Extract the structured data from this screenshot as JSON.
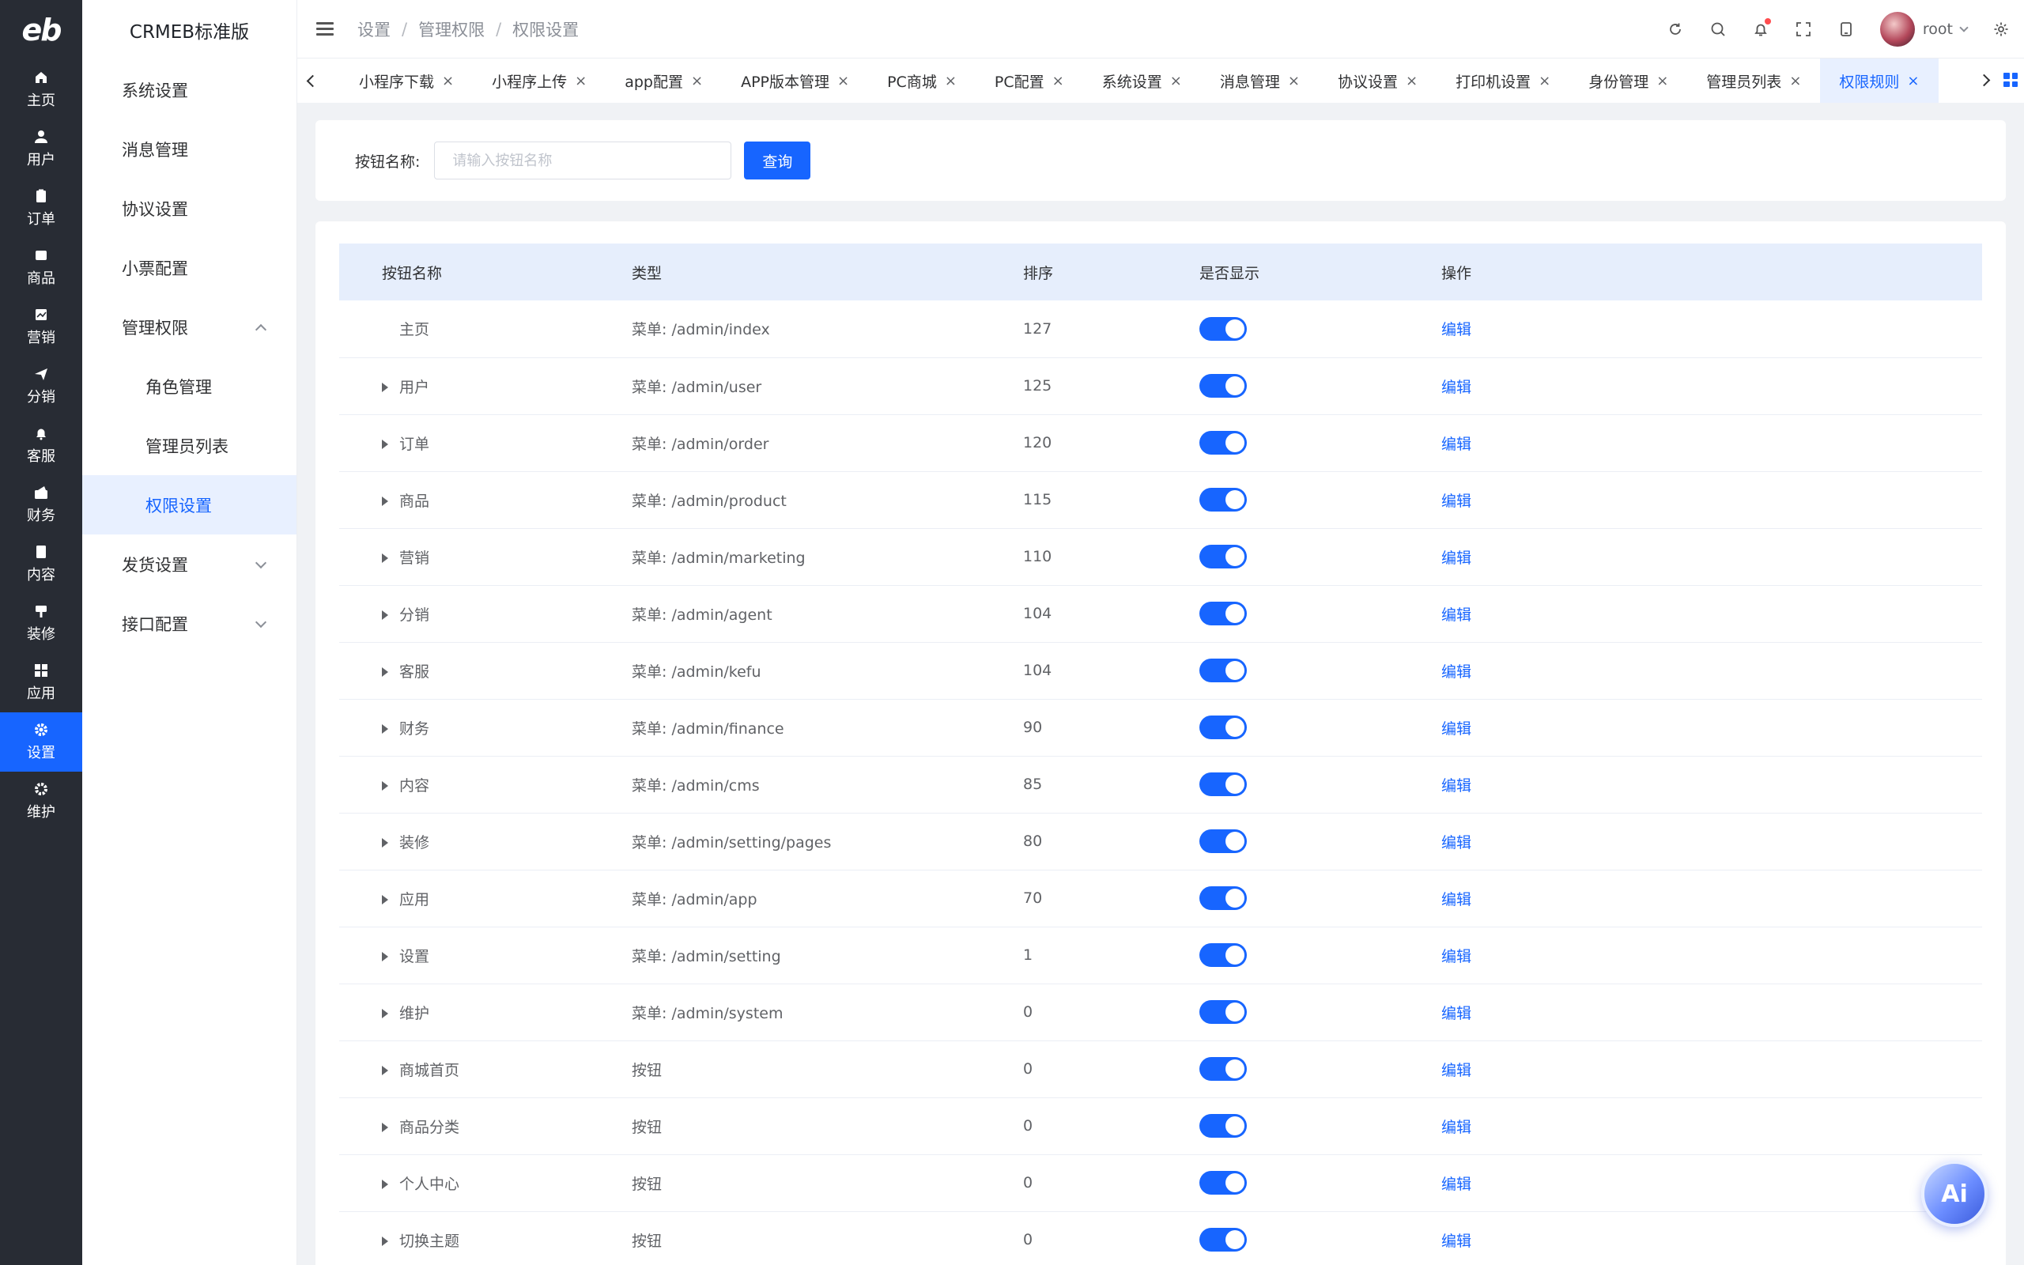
{
  "rail": {
    "logo": "eb",
    "items": [
      {
        "label": "主页",
        "icon": "home-icon"
      },
      {
        "label": "用户",
        "icon": "user-icon"
      },
      {
        "label": "订单",
        "icon": "order-icon"
      },
      {
        "label": "商品",
        "icon": "product-icon"
      },
      {
        "label": "营销",
        "icon": "marketing-icon"
      },
      {
        "label": "分销",
        "icon": "distribution-icon"
      },
      {
        "label": "客服",
        "icon": "service-bell-icon"
      },
      {
        "label": "财务",
        "icon": "finance-icon"
      },
      {
        "label": "内容",
        "icon": "content-icon"
      },
      {
        "label": "装修",
        "icon": "decoration-icon"
      },
      {
        "label": "应用",
        "icon": "apps-icon"
      },
      {
        "label": "设置",
        "icon": "gear-icon",
        "active": true
      },
      {
        "label": "维护",
        "icon": "maintenance-icon"
      }
    ]
  },
  "sidebar": {
    "brand": "CRMEB标准版",
    "items": [
      {
        "label": "系统设置"
      },
      {
        "label": "消息管理"
      },
      {
        "label": "协议设置"
      },
      {
        "label": "小票配置"
      },
      {
        "label": "管理权限",
        "expanded": true
      },
      {
        "label": "角色管理",
        "sub": true
      },
      {
        "label": "管理员列表",
        "sub": true
      },
      {
        "label": "权限设置",
        "sub": true,
        "active": true
      },
      {
        "label": "发货设置",
        "collapsible": true
      },
      {
        "label": "接口配置",
        "collapsible": true
      }
    ]
  },
  "header": {
    "breadcrumb": [
      "设置",
      "管理权限",
      "权限设置"
    ],
    "breadcrumb_sep": "/",
    "username": "root"
  },
  "tags": [
    {
      "label": "小程序下载"
    },
    {
      "label": "小程序上传"
    },
    {
      "label": "app配置"
    },
    {
      "label": "APP版本管理"
    },
    {
      "label": "PC商城"
    },
    {
      "label": "PC配置"
    },
    {
      "label": "系统设置"
    },
    {
      "label": "消息管理"
    },
    {
      "label": "协议设置"
    },
    {
      "label": "打印机设置"
    },
    {
      "label": "身份管理"
    },
    {
      "label": "管理员列表"
    },
    {
      "label": "权限规则",
      "active": true
    }
  ],
  "search": {
    "label": "按钮名称:",
    "placeholder": "请输入按钮名称",
    "value": "",
    "button": "查询"
  },
  "table": {
    "columns": [
      "按钮名称",
      "类型",
      "排序",
      "是否显示",
      "操作"
    ],
    "edit_label": "编辑",
    "rows": [
      {
        "name": "主页",
        "type": "菜单: /admin/index",
        "sort": "127",
        "show": true,
        "expandable": false
      },
      {
        "name": "用户",
        "type": "菜单: /admin/user",
        "sort": "125",
        "show": true,
        "expandable": true
      },
      {
        "name": "订单",
        "type": "菜单: /admin/order",
        "sort": "120",
        "show": true,
        "expandable": true
      },
      {
        "name": "商品",
        "type": "菜单: /admin/product",
        "sort": "115",
        "show": true,
        "expandable": true
      },
      {
        "name": "营销",
        "type": "菜单: /admin/marketing",
        "sort": "110",
        "show": true,
        "expandable": true
      },
      {
        "name": "分销",
        "type": "菜单: /admin/agent",
        "sort": "104",
        "show": true,
        "expandable": true
      },
      {
        "name": "客服",
        "type": "菜单: /admin/kefu",
        "sort": "104",
        "show": true,
        "expandable": true
      },
      {
        "name": "财务",
        "type": "菜单: /admin/finance",
        "sort": "90",
        "show": true,
        "expandable": true
      },
      {
        "name": "内容",
        "type": "菜单: /admin/cms",
        "sort": "85",
        "show": true,
        "expandable": true
      },
      {
        "name": "装修",
        "type": "菜单: /admin/setting/pages",
        "sort": "80",
        "show": true,
        "expandable": true
      },
      {
        "name": "应用",
        "type": "菜单: /admin/app",
        "sort": "70",
        "show": true,
        "expandable": true
      },
      {
        "name": "设置",
        "type": "菜单: /admin/setting",
        "sort": "1",
        "show": true,
        "expandable": true
      },
      {
        "name": "维护",
        "type": "菜单: /admin/system",
        "sort": "0",
        "show": true,
        "expandable": true
      },
      {
        "name": "商城首页",
        "type": "按钮",
        "sort": "0",
        "show": true,
        "expandable": true
      },
      {
        "name": "商品分类",
        "type": "按钮",
        "sort": "0",
        "show": true,
        "expandable": true
      },
      {
        "name": "个人中心",
        "type": "按钮",
        "sort": "0",
        "show": true,
        "expandable": true
      },
      {
        "name": "切换主题",
        "type": "按钮",
        "sort": "0",
        "show": true,
        "expandable": true
      }
    ]
  },
  "ai_button": "Ai",
  "colors": {
    "accent": "#1765ff",
    "rail_bg": "#282c34",
    "header_row": "#e6eefc"
  }
}
